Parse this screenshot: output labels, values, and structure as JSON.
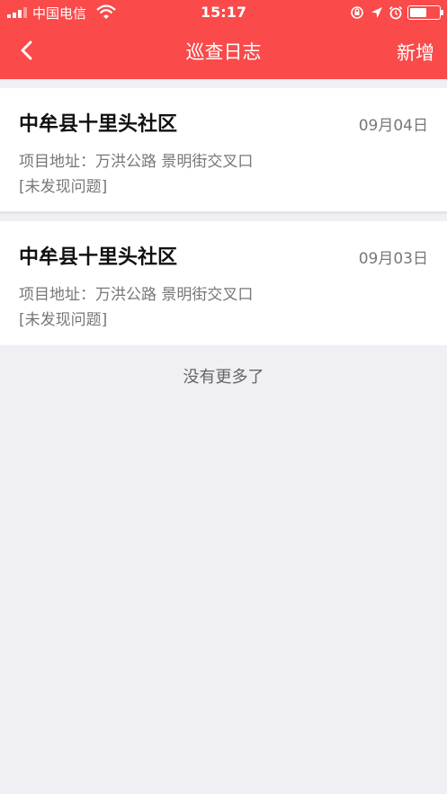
{
  "status_bar": {
    "carrier": "中国电信",
    "time": "15:17"
  },
  "nav": {
    "title": "巡查日志",
    "right_action": "新增",
    "back_icon": "chevron-left-icon"
  },
  "logs": [
    {
      "title": "中牟县十里头社区",
      "date": "09月04日",
      "address": "项目地址：万洪公路 景明街交叉口",
      "status": "[未发现问题]"
    },
    {
      "title": "中牟县十里头社区",
      "date": "09月03日",
      "address": "项目地址：万洪公路 景明街交叉口",
      "status": "[未发现问题]"
    }
  ],
  "footer": {
    "no_more": "没有更多了"
  },
  "colors": {
    "header": "#fa4a4a",
    "background": "#efeff4"
  }
}
